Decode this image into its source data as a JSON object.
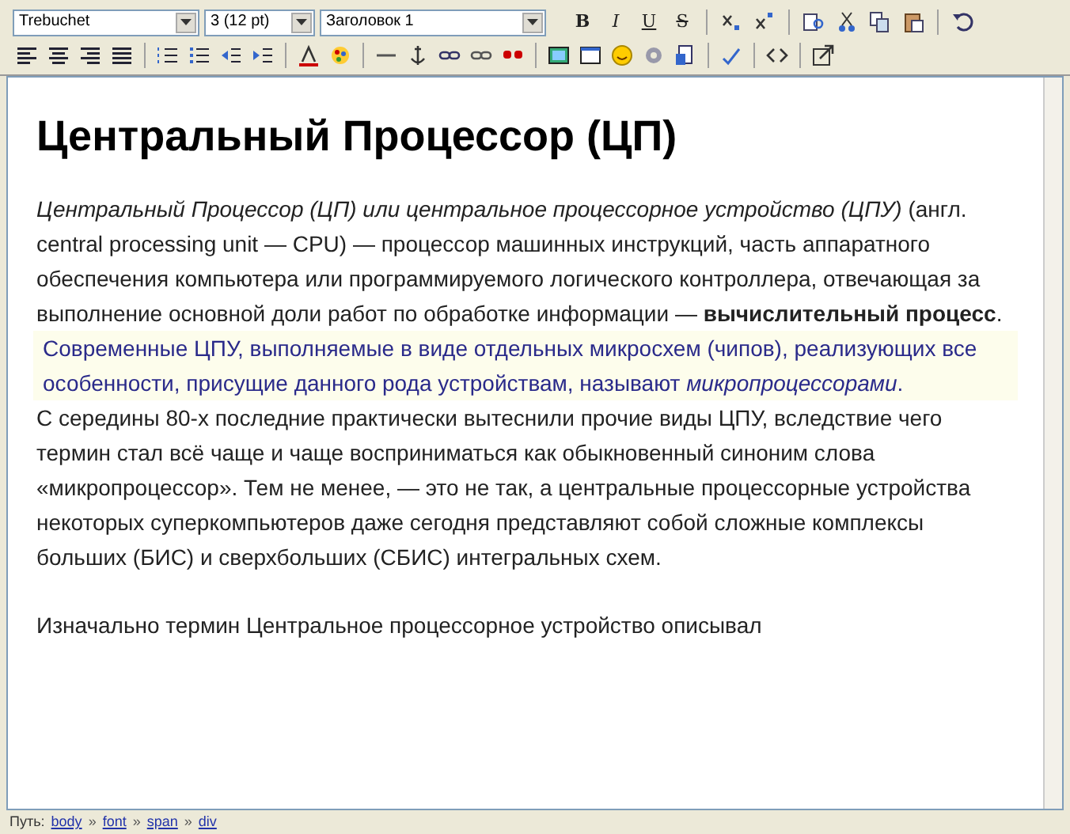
{
  "toolbar": {
    "font": "Trebuchet",
    "size": "3 (12 pt)",
    "format": "Заголовок 1",
    "format_buttons": [
      "B",
      "I",
      "U",
      "S"
    ]
  },
  "document": {
    "heading": "Центральный Процессор (ЦП)",
    "blocks": [
      {
        "kind": "paragraph",
        "text": "*Центральный Процессор (ЦП) или центральное процессорное устройство (ЦПУ)* (англ. central processing unit — CPU) — процессор машинных инструкций, часть аппаратного обеспечения компьютера или программируемого логического контроллера, отвечающая за выполнение основной доли работ по обработке информации — **вычислительный процесс**."
      },
      {
        "kind": "quote",
        "text": "Современные ЦПУ, выполняемые в виде отдельных микросхем (чипов), реализующих все особенности, присущие данного рода устройствам, называют *микропроцессорами*."
      },
      {
        "kind": "paragraph",
        "text": "С середины 80-х последние практически вытеснили прочие виды ЦПУ, вследствие чего термин стал всё чаще и чаще восприниматься как обыкновенный синоним слова «микропроцессор». Тем не менее, — это не так, а центральные процессорные устройства некоторых суперкомпьютеров даже сегодня представляют собой сложные комплексы больших (БИС) и сверхбольших (СБИС) интегральных схем."
      },
      {
        "kind": "gap"
      },
      {
        "kind": "paragraph",
        "text": "Изначально термин Центральное процессорное устройство описывал"
      }
    ]
  },
  "path_bar": {
    "label": "Путь:",
    "items": [
      "body",
      "font",
      "span",
      "div"
    ],
    "separator": "»"
  }
}
